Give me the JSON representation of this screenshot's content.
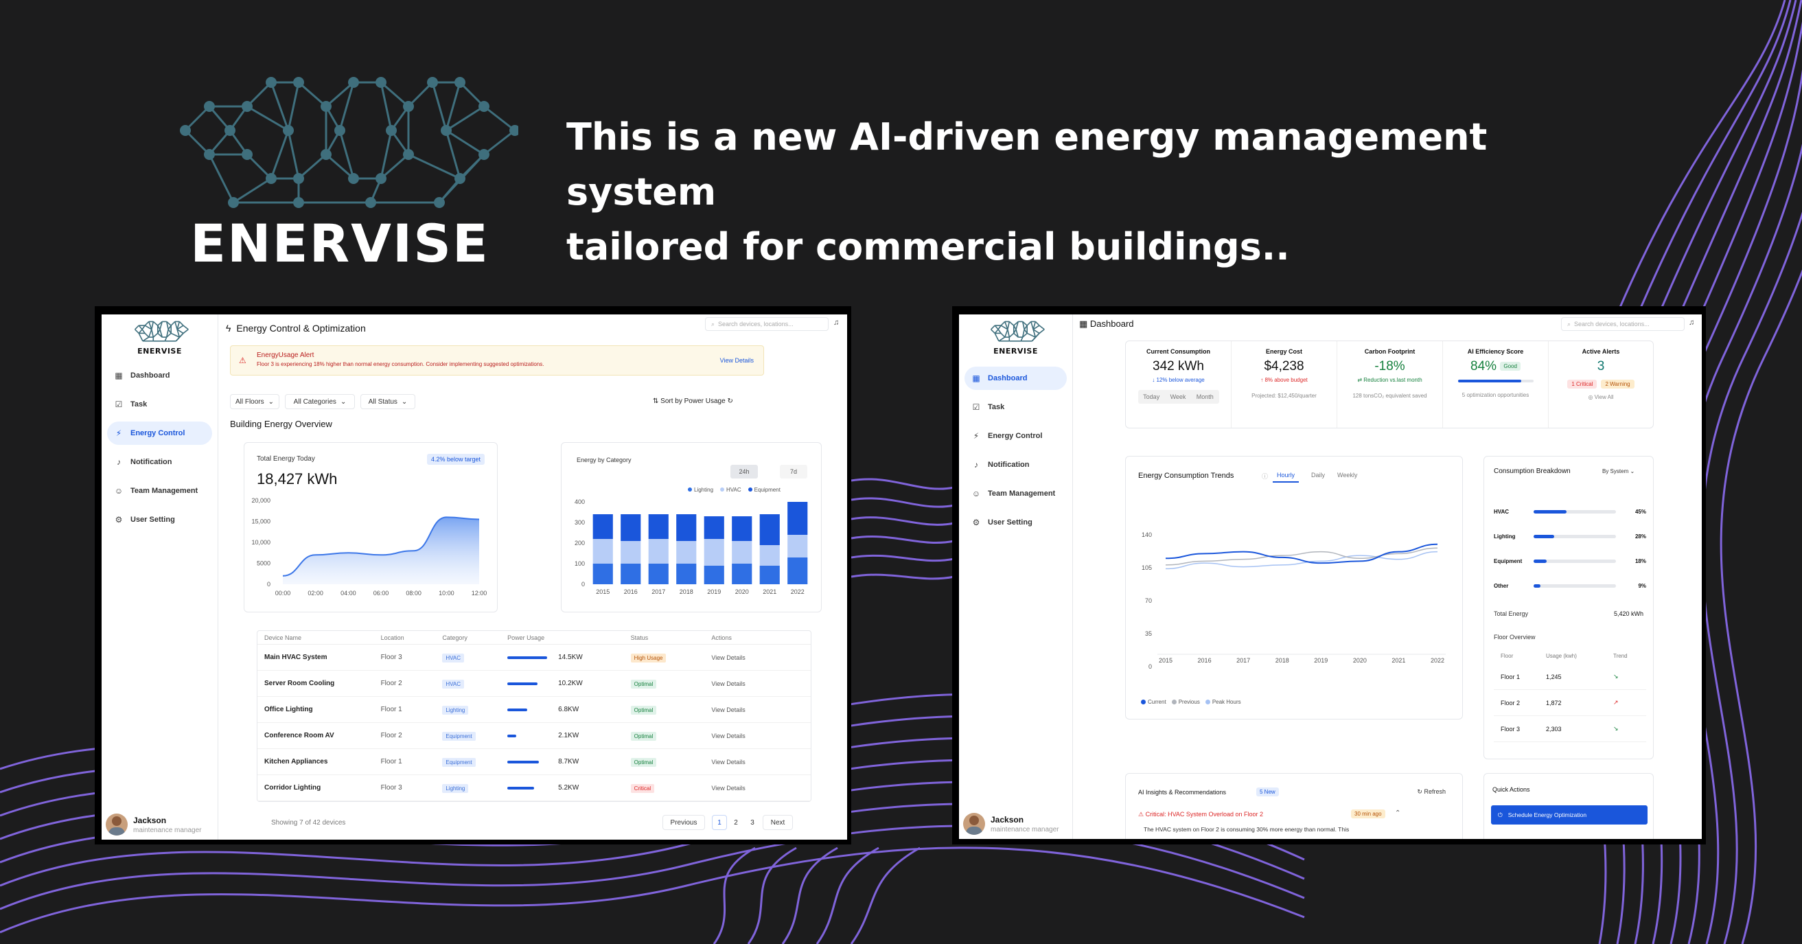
{
  "hero": {
    "brand": "ENERVISE",
    "tagline_line1": "This is a new AI-driven energy management system",
    "tagline_line2": "tailored for commercial buildings.."
  },
  "colors": {
    "background": "#1c1c1d",
    "accent_purple": "#8b6cf0",
    "logo_teal": "#3f6f7d",
    "primary_blue": "#1a56db"
  },
  "screen1": {
    "sidebar": {
      "brand": "ENERVISE",
      "items": [
        {
          "label": "Dashboard",
          "icon": "dashboard-icon"
        },
        {
          "label": "Task",
          "icon": "task-icon"
        },
        {
          "label": "Energy Control",
          "icon": "energy-icon"
        },
        {
          "label": "Notification",
          "icon": "bell-icon"
        },
        {
          "label": "Team Management",
          "icon": "team-icon"
        },
        {
          "label": "User Setting",
          "icon": "gear-icon"
        }
      ],
      "user_name": "Jackson",
      "user_role": "maintenance manager"
    },
    "header_title": "Energy Control & Optimization",
    "search_placeholder": "Search devices, locations...",
    "alert": {
      "title": "EnergyUsage Alert",
      "message": "Floor 3 is experiencing 18% higher than normal energy consumption. Consider implementing suggested optimizations.",
      "action": "View Details"
    },
    "filters": [
      "All Floors",
      "All Categories",
      "All Status"
    ],
    "sort_label": "Sort by Power Usage",
    "section_title": "Building Energy Overview",
    "total_card": {
      "label": "Total Energy Today",
      "badge": "4.2% below target",
      "value": "18,427 kWh",
      "chart_data": {
        "type": "area",
        "x": [
          "00:00",
          "02:00",
          "04:00",
          "06:00",
          "08:00",
          "10:00",
          "12:00"
        ],
        "values": [
          2000,
          7000,
          7500,
          7000,
          8000,
          16000,
          15500
        ],
        "yticks": [
          "20,000",
          "15,000",
          "10,000",
          "5000",
          "0"
        ],
        "ylim": [
          0,
          20000
        ]
      }
    },
    "category_card": {
      "label": "Energy by Category",
      "toggle": [
        "24h",
        "7d"
      ],
      "chart_data": {
        "type": "bar",
        "categories": [
          "2015",
          "2016",
          "2017",
          "2018",
          "2019",
          "2020",
          "2021",
          "2022"
        ],
        "series": [
          {
            "name": "Lighting",
            "values": [
              100,
              100,
              100,
              100,
              90,
              100,
              90,
              130
            ],
            "color": "#2f6fe4"
          },
          {
            "name": "HVAC",
            "values": [
              120,
              110,
              120,
              110,
              130,
              110,
              100,
              110
            ],
            "color": "#b7cdf7"
          },
          {
            "name": "Equipment",
            "values": [
              120,
              130,
              120,
              130,
              110,
              120,
              150,
              160
            ],
            "color": "#1a56db"
          }
        ],
        "yticks": [
          "400",
          "300",
          "200",
          "100",
          "0"
        ],
        "ylim": [
          0,
          400
        ]
      }
    },
    "table": {
      "headers": [
        "Device Name",
        "Location",
        "Category",
        "Power Usage",
        "Status",
        "Actions"
      ],
      "rows": [
        {
          "name": "Main HVAC System",
          "location": "Floor 3",
          "category": "HVAC",
          "usage": "14.5KW",
          "fill": 0.9,
          "status": "High Usage",
          "status_class": "st-high",
          "action": "View Details"
        },
        {
          "name": "Server Room Cooling",
          "location": "Floor 2",
          "category": "HVAC",
          "usage": "10.2KW",
          "fill": 0.68,
          "status": "Optimal",
          "status_class": "st-opt",
          "action": "View Details"
        },
        {
          "name": "Office Lighting",
          "location": "Floor 1",
          "category": "Lighting",
          "usage": "6.8KW",
          "fill": 0.45,
          "status": "Optimal",
          "status_class": "st-opt",
          "action": "View Details"
        },
        {
          "name": "Conference Room AV",
          "location": "Floor 2",
          "category": "Equipment",
          "usage": "2.1KW",
          "fill": 0.2,
          "status": "Optimal",
          "status_class": "st-opt",
          "action": "View Details"
        },
        {
          "name": "Kitchen Appliances",
          "location": "Floor 1",
          "category": "Equipment",
          "usage": "8.7KW",
          "fill": 0.72,
          "status": "Optimal",
          "status_class": "st-opt",
          "action": "View Details"
        },
        {
          "name": "Corridor Lighting",
          "location": "Floor 3",
          "category": "Lighting",
          "usage": "5.2KW",
          "fill": 0.6,
          "status": "Critical",
          "status_class": "st-crit",
          "action": "View Details"
        }
      ],
      "footer": "Showing 7 of 42 devices",
      "pager": [
        "Previous",
        "1",
        "2",
        "3",
        "Next"
      ]
    }
  },
  "screen2": {
    "sidebar": {
      "brand": "ENERVISE",
      "items": [
        {
          "label": "Dashboard",
          "icon": "dashboard-icon"
        },
        {
          "label": "Task",
          "icon": "task-icon"
        },
        {
          "label": "Energy Control",
          "icon": "energy-icon"
        },
        {
          "label": "Notification",
          "icon": "bell-icon"
        },
        {
          "label": "Team Management",
          "icon": "team-icon"
        },
        {
          "label": "User Setting",
          "icon": "gear-icon"
        }
      ],
      "user_name": "Jackson",
      "user_role": "maintenance manager"
    },
    "header_title": "Dashboard",
    "search_placeholder": "Search devices, locations...",
    "metrics": [
      {
        "label": "Current Consumption",
        "value": "342 kWh",
        "sub": "↓ 12% below average",
        "sub_color": "#1a56db"
      },
      {
        "label": "Energy Cost",
        "value": "$4,238",
        "sub": "↑ 8% above budget",
        "sub_color": "#dc2626"
      },
      {
        "label": "Carbon Footprint",
        "value": "-18%",
        "sub": "⇄ Reduction vs.last month",
        "sub_color": "#15803d"
      },
      {
        "label": "AI Efficiency Score",
        "value": "84%",
        "sub": "",
        "sub_color": "#15803d"
      },
      {
        "label": "Active Alerts",
        "value": "3",
        "sub": "",
        "sub_color": "#333"
      }
    ],
    "metric_extras": {
      "range_tabs": [
        "Today",
        "Week",
        "Month"
      ],
      "projected": "Projected: $12,450/quarter",
      "carbon_saved": "128 tonsCO₂ equivalent saved",
      "good_badge": "Good",
      "efficiency_fill": 0.84,
      "opt_opps": "5 optimization opportunities",
      "critical_badge": "1 Critical",
      "warning_badge": "2 Warning",
      "view_all": "View All"
    },
    "trends": {
      "title": "Energy Consumption Trends",
      "tabs": [
        "Hourly",
        "Daily",
        "Weekly"
      ],
      "chart_data": {
        "type": "line",
        "x": [
          "2015",
          "2016",
          "2017",
          "2018",
          "2019",
          "2020",
          "2021",
          "2022"
        ],
        "series": [
          {
            "name": "Current",
            "values": [
              115,
              120,
              122,
              116,
              110,
              112,
              122,
              130
            ],
            "color": "#1a56db"
          },
          {
            "name": "Previous",
            "values": [
              108,
              112,
              114,
              118,
              122,
              115,
              120,
              126
            ],
            "color": "#b0b4bb"
          },
          {
            "name": "Peak Hours",
            "values": [
              104,
              110,
              106,
              108,
              112,
              118,
              114,
              122
            ],
            "color": "#a5c1f3"
          }
        ],
        "yticks": [
          "140",
          "105",
          "70",
          "35",
          "0"
        ],
        "ylim": [
          0,
          140
        ]
      }
    },
    "breakdown": {
      "title": "Consumption Breakdown",
      "dropdown": "By System",
      "rows": [
        {
          "label": "HVAC",
          "pct": "45%",
          "fill": 0.45
        },
        {
          "label": "Lighting",
          "pct": "28%",
          "fill": 0.28
        },
        {
          "label": "Equipment",
          "pct": "18%",
          "fill": 0.18
        },
        {
          "label": "Other",
          "pct": "9%",
          "fill": 0.09
        }
      ],
      "total_label": "Total Energy",
      "total_value": "5,420 kWh",
      "floor_title": "Floor Overview",
      "floor_headers": [
        "Floor",
        "Usage (kwh)",
        "Trend"
      ],
      "floors": [
        {
          "floor": "Floor 1",
          "usage": "1,245",
          "trend": "↘",
          "trend_color": "#15803d"
        },
        {
          "floor": "Floor 2",
          "usage": "1,872",
          "trend": "↗",
          "trend_color": "#dc2626"
        },
        {
          "floor": "Floor 3",
          "usage": "2,303",
          "trend": "↘",
          "trend_color": "#15803d"
        }
      ]
    },
    "insights": {
      "title": "AI Insights & Recommendations",
      "badge": "5 New",
      "refresh": "Refresh",
      "item_title": "Critical: HVAC System Overload on Floor 2",
      "item_time": "30 min ago",
      "item_text": "The HVAC system on Floor 2 is consuming 30% more energy than normal. This"
    },
    "quick_actions": {
      "title": "Quick Actions",
      "primary": "Schedule Energy Optimization"
    }
  }
}
